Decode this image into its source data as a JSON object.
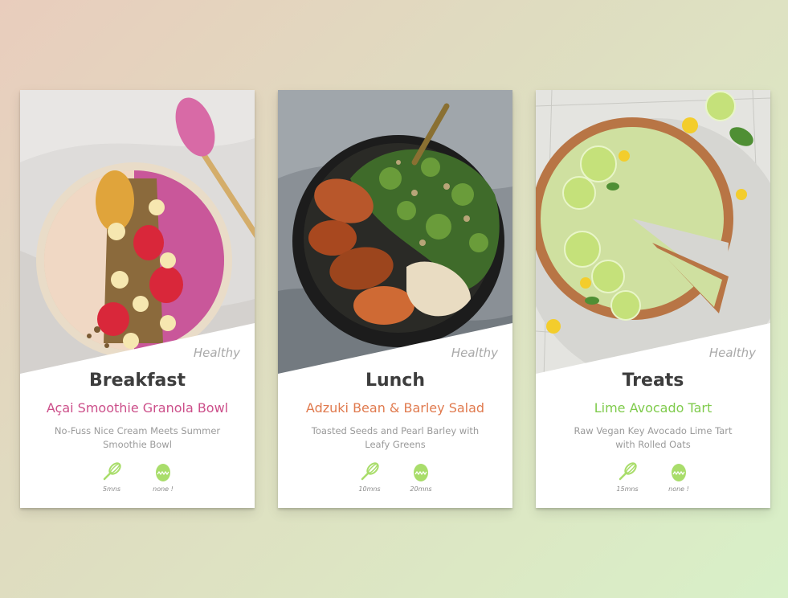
{
  "accent_color": "#a9dd6b",
  "cards": [
    {
      "tag": "Healthy",
      "meal": "Breakfast",
      "recipe": "Açai Smoothie Granola Bowl",
      "recipe_color": "#cc4f8a",
      "description": "No-Fuss Nice Cream Meets Summer Smoothie Bowl",
      "prep_icon": "whisk-icon",
      "prep_time": "5mns",
      "cook_icon": "egg-timer-icon",
      "cook_time": "none !"
    },
    {
      "tag": "Healthy",
      "meal": "Lunch",
      "recipe": "Adzuki Bean & Barley Salad",
      "recipe_color": "#e07a4e",
      "description": "Toasted Seeds and Pearl Barley with Leafy Greens",
      "prep_icon": "whisk-icon",
      "prep_time": "10mns",
      "cook_icon": "egg-timer-icon",
      "cook_time": "20mns"
    },
    {
      "tag": "Healthy",
      "meal": "Treats",
      "recipe": "Lime Avocado Tart",
      "recipe_color": "#7fcb4c",
      "description": "Raw Vegan Key Avocado Lime Tart with Rolled Oats",
      "prep_icon": "whisk-icon",
      "prep_time": "15mns",
      "cook_icon": "egg-timer-icon",
      "cook_time": "none !"
    }
  ]
}
